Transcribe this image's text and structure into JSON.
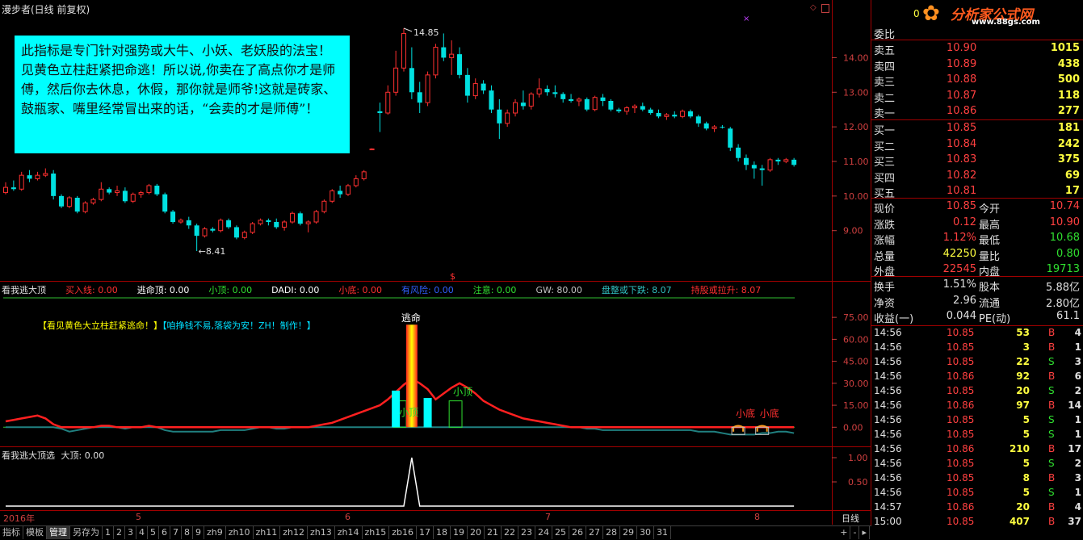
{
  "title": "漫步者(日线 前复权)",
  "callout": "此指标是专门针对强势或大牛、小妖、老妖股的法宝！见黄色立柱赶紧把命逃！所以说,你卖在了高点你才是师傅，然后你去休息，休假，那你就是师爷!这就是砖家、鼓瓶家、嘴里经常冒出来的话，“会卖的才是师傅”！",
  "price_annotations": {
    "high": "14.85",
    "low": "8.41",
    "dollar": "$"
  },
  "indicator1": {
    "name": "看我逃大顶",
    "items": [
      {
        "label": "买入线: 0.00",
        "color": "#ff3030"
      },
      {
        "label": "逃命顶: 0.00",
        "color": "#ffffff"
      },
      {
        "label": "小顶: 0.00",
        "color": "#30e030"
      },
      {
        "label": "DADI: 0.00",
        "color": "#ffffff"
      },
      {
        "label": "小底: 0.00",
        "color": "#ff3030"
      },
      {
        "label": "有风险: 0.00",
        "color": "#3060ff"
      },
      {
        "label": "注意: 0.00",
        "color": "#30e030"
      },
      {
        "label": "GW: 80.00",
        "color": "#c0c0c0"
      },
      {
        "label": "盘整或下跌: 8.07",
        "color": "#30c0c0"
      },
      {
        "label": "持股或拉升: 8.07",
        "color": "#ff3030"
      }
    ],
    "banner_a": "【看见黄色大立柱赶紧逃命！】",
    "banner_b": "【咱挣钱不易,落袋为安！ZH！制作！】",
    "label_escape": "逃命",
    "label_small_top": "小顶",
    "label_small_bottom": "小底"
  },
  "indicator2": {
    "name": "看我逃大顶选",
    "value": "大顶: 0.00"
  },
  "xaxis": {
    "year": "2016年",
    "months": [
      "5",
      "6",
      "7",
      "8"
    ],
    "period": "日线"
  },
  "chart_data": [
    {
      "type": "candlestick",
      "title": "漫步者(日线 前复权)",
      "yticks": [
        9.0,
        10.0,
        11.0,
        12.0,
        13.0,
        14.0
      ],
      "ylim": [
        8.2,
        15.2
      ],
      "ohlc": [
        [
          10.1,
          10.4,
          10.05,
          10.25
        ],
        [
          10.25,
          10.45,
          10.15,
          10.2
        ],
        [
          10.2,
          10.7,
          10.15,
          10.6
        ],
        [
          10.6,
          10.75,
          10.4,
          10.5
        ],
        [
          10.5,
          10.7,
          10.45,
          10.6
        ],
        [
          10.6,
          10.8,
          10.55,
          10.65
        ],
        [
          10.65,
          10.75,
          9.9,
          10.0
        ],
        [
          10.0,
          10.05,
          9.65,
          9.7
        ],
        [
          9.7,
          10.0,
          9.65,
          9.95
        ],
        [
          9.95,
          10.0,
          9.5,
          9.55
        ],
        [
          9.55,
          9.85,
          9.5,
          9.8
        ],
        [
          9.8,
          9.95,
          9.75,
          9.9
        ],
        [
          9.9,
          10.4,
          9.85,
          10.2
        ],
        [
          10.2,
          10.25,
          10.05,
          10.1
        ],
        [
          10.1,
          10.3,
          10.0,
          10.15
        ],
        [
          10.15,
          10.25,
          9.8,
          9.85
        ],
        [
          9.85,
          10.1,
          9.8,
          10.05
        ],
        [
          10.05,
          10.15,
          9.95,
          10.1
        ],
        [
          10.1,
          10.35,
          10.05,
          10.3
        ],
        [
          10.3,
          10.35,
          10.0,
          10.05
        ],
        [
          10.05,
          10.1,
          9.5,
          9.55
        ],
        [
          9.55,
          9.6,
          9.2,
          9.25
        ],
        [
          9.25,
          9.35,
          9.2,
          9.3
        ],
        [
          9.3,
          9.4,
          9.05,
          9.15
        ],
        [
          9.15,
          9.2,
          8.41,
          8.85
        ],
        [
          8.85,
          9.1,
          8.8,
          9.05
        ],
        [
          9.05,
          9.1,
          8.95,
          9.0
        ],
        [
          9.0,
          9.35,
          8.95,
          9.3
        ],
        [
          9.3,
          9.35,
          9.05,
          9.1
        ],
        [
          9.1,
          9.15,
          8.75,
          8.8
        ],
        [
          8.8,
          9.0,
          8.75,
          8.95
        ],
        [
          8.95,
          9.25,
          8.9,
          9.2
        ],
        [
          9.2,
          9.35,
          9.15,
          9.3
        ],
        [
          9.3,
          9.35,
          9.15,
          9.25
        ],
        [
          9.25,
          9.35,
          9.05,
          9.1
        ],
        [
          9.1,
          9.3,
          9.0,
          9.25
        ],
        [
          9.25,
          9.55,
          9.2,
          9.5
        ],
        [
          9.5,
          9.55,
          9.15,
          9.2
        ],
        [
          9.2,
          9.3,
          8.95,
          9.25
        ],
        [
          9.25,
          9.6,
          9.2,
          9.55
        ],
        [
          9.55,
          9.9,
          9.5,
          9.85
        ],
        [
          9.85,
          10.2,
          9.8,
          10.15
        ],
        [
          10.15,
          10.3,
          9.95,
          10.05
        ],
        [
          10.05,
          10.35,
          10.0,
          10.3
        ],
        [
          10.3,
          10.6,
          10.25,
          10.5
        ],
        [
          10.5,
          10.75,
          10.45,
          10.7
        ],
        [
          11.35,
          11.38,
          11.34,
          11.36
        ],
        [
          12.45,
          12.7,
          11.85,
          12.4
        ],
        [
          12.4,
          13.2,
          12.35,
          13.0
        ],
        [
          13.0,
          14.2,
          12.9,
          13.7
        ],
        [
          13.7,
          14.85,
          13.6,
          14.7
        ],
        [
          13.7,
          14.3,
          12.8,
          13.0
        ],
        [
          13.0,
          13.3,
          12.4,
          12.7
        ],
        [
          12.7,
          13.6,
          12.6,
          13.5
        ],
        [
          13.5,
          14.4,
          13.4,
          14.3
        ],
        [
          14.3,
          14.7,
          13.9,
          14.0
        ],
        [
          14.0,
          14.5,
          13.5,
          14.1
        ],
        [
          14.1,
          14.3,
          13.4,
          13.5
        ],
        [
          13.5,
          13.7,
          12.7,
          12.9
        ],
        [
          12.9,
          13.4,
          12.8,
          13.25
        ],
        [
          13.25,
          13.35,
          12.95,
          13.05
        ],
        [
          13.05,
          13.2,
          12.4,
          12.5
        ],
        [
          12.5,
          12.8,
          11.65,
          12.1
        ],
        [
          12.1,
          12.5,
          12.0,
          12.4
        ],
        [
          12.4,
          12.8,
          12.3,
          12.7
        ],
        [
          12.7,
          13.05,
          12.5,
          12.6
        ],
        [
          12.6,
          13.0,
          12.5,
          12.95
        ],
        [
          12.95,
          13.4,
          12.85,
          13.1
        ],
        [
          13.1,
          13.2,
          12.9,
          13.0
        ],
        [
          13.0,
          13.2,
          12.85,
          12.95
        ],
        [
          12.95,
          13.0,
          12.7,
          12.8
        ],
        [
          12.8,
          12.95,
          12.7,
          12.75
        ],
        [
          12.75,
          12.85,
          12.6,
          12.8
        ],
        [
          12.8,
          12.85,
          12.45,
          12.5
        ],
        [
          12.5,
          12.9,
          12.45,
          12.85
        ],
        [
          12.85,
          12.95,
          12.6,
          12.75
        ],
        [
          12.75,
          12.8,
          12.45,
          12.5
        ],
        [
          12.5,
          12.55,
          12.4,
          12.45
        ],
        [
          12.45,
          12.6,
          12.35,
          12.55
        ],
        [
          12.55,
          12.65,
          12.4,
          12.6
        ],
        [
          12.6,
          12.7,
          12.45,
          12.5
        ],
        [
          12.5,
          12.55,
          12.35,
          12.4
        ],
        [
          12.4,
          12.5,
          12.25,
          12.3
        ],
        [
          12.3,
          12.4,
          12.2,
          12.35
        ],
        [
          12.35,
          12.45,
          12.25,
          12.3
        ],
        [
          12.3,
          12.5,
          12.25,
          12.45
        ],
        [
          12.45,
          12.5,
          12.25,
          12.3
        ],
        [
          12.3,
          12.35,
          12.0,
          12.1
        ],
        [
          12.1,
          12.15,
          11.9,
          11.95
        ],
        [
          11.95,
          12.05,
          11.85,
          12.0
        ],
        [
          12.0,
          12.05,
          11.95,
          11.98
        ],
        [
          11.95,
          12.0,
          11.3,
          11.4
        ],
        [
          11.4,
          11.5,
          11.0,
          11.1
        ],
        [
          11.1,
          11.2,
          10.75,
          10.9
        ],
        [
          10.9,
          11.0,
          10.5,
          10.8
        ],
        [
          10.8,
          10.9,
          10.3,
          10.75
        ],
        [
          10.75,
          11.1,
          10.7,
          11.05
        ],
        [
          11.05,
          11.1,
          10.9,
          11.0
        ],
        [
          11.0,
          11.1,
          10.95,
          11.05
        ],
        [
          11.05,
          11.1,
          10.85,
          10.9
        ]
      ]
    },
    {
      "type": "line",
      "title": "看我逃大顶",
      "yticks": [
        0.0,
        15.0,
        30.0,
        45.0,
        60.0,
        75.0
      ],
      "ylim": [
        -7,
        85
      ],
      "series": [
        {
          "name": "持股或拉升",
          "values": [
            4,
            5,
            6,
            7,
            8,
            6,
            2,
            -1,
            -3,
            -2,
            -1,
            0,
            1,
            1,
            0,
            -1,
            0,
            0,
            1,
            0,
            -2,
            -3,
            -3,
            -3,
            -3,
            -3,
            -3,
            -2,
            -2,
            -2,
            -2,
            -1,
            0,
            0,
            -1,
            -1,
            0,
            0,
            0,
            1,
            2,
            3,
            5,
            7,
            9,
            11,
            13,
            15,
            19,
            24,
            29,
            33,
            30,
            26,
            19,
            23,
            27,
            30,
            27,
            23,
            18,
            15,
            12,
            10,
            8,
            6,
            5,
            4,
            3,
            2,
            1,
            0,
            0,
            -1,
            -1,
            -2,
            -2,
            -2,
            -2,
            -2,
            -2,
            -2,
            -2,
            -2,
            -2,
            -2,
            -2,
            -3,
            -3,
            -3,
            -4,
            -5,
            -5,
            -5,
            -5,
            -4,
            -4,
            -3,
            -3,
            -4
          ]
        }
      ],
      "bars": [
        {
          "name": "逃命顶",
          "index": 51,
          "value": 70
        },
        {
          "name": "有风险",
          "index": 49,
          "value": 25
        },
        {
          "name": "有风险",
          "index": 53,
          "value": 20
        }
      ]
    },
    {
      "type": "line",
      "title": "看我逃大顶选",
      "yticks": [
        0.5,
        1.0
      ],
      "ylim": [
        -0.05,
        1.15
      ],
      "series": [
        {
          "name": "大顶",
          "values": [
            0,
            0,
            0,
            0,
            0,
            0,
            0,
            0,
            0,
            0,
            0,
            0,
            0,
            0,
            0,
            0,
            0,
            0,
            0,
            0,
            0,
            0,
            0,
            0,
            0,
            0,
            0,
            0,
            0,
            0,
            0,
            0,
            0,
            0,
            0,
            0,
            0,
            0,
            0,
            0,
            0,
            0,
            0,
            0,
            0,
            0,
            0,
            0,
            0,
            0,
            0,
            1,
            0,
            0,
            0,
            0,
            0,
            0,
            0,
            0,
            0,
            0,
            0,
            0,
            0,
            0,
            0,
            0,
            0,
            0,
            0,
            0,
            0,
            0,
            0,
            0,
            0,
            0,
            0,
            0,
            0,
            0,
            0,
            0,
            0,
            0,
            0,
            0,
            0,
            0,
            0,
            0,
            0,
            0,
            0,
            0,
            0,
            0,
            0,
            0
          ]
        }
      ]
    }
  ],
  "quote_panel": {
    "price_header": "0",
    "weibi_label": "委比",
    "asks": [
      {
        "label": "卖五",
        "price": "10.90",
        "vol": "1015"
      },
      {
        "label": "卖四",
        "price": "10.89",
        "vol": "438"
      },
      {
        "label": "卖三",
        "price": "10.88",
        "vol": "500"
      },
      {
        "label": "卖二",
        "price": "10.87",
        "vol": "118"
      },
      {
        "label": "卖一",
        "price": "10.86",
        "vol": "277"
      }
    ],
    "bids": [
      {
        "label": "买一",
        "price": "10.85",
        "vol": "181"
      },
      {
        "label": "买二",
        "price": "10.84",
        "vol": "242"
      },
      {
        "label": "买三",
        "price": "10.83",
        "vol": "375"
      },
      {
        "label": "买四",
        "price": "10.82",
        "vol": "69"
      },
      {
        "label": "买五",
        "price": "10.81",
        "vol": "17"
      }
    ],
    "stats": [
      {
        "l1": "现价",
        "v1": "10.85",
        "c1": "#ff4040",
        "l2": "今开",
        "v2": "10.74",
        "c2": "#ff4040"
      },
      {
        "l1": "涨跌",
        "v1": "0.12",
        "c1": "#ff4040",
        "l2": "最高",
        "v2": "10.90",
        "c2": "#ff4040"
      },
      {
        "l1": "涨幅",
        "v1": "1.12%",
        "c1": "#ff4040",
        "l2": "最低",
        "v2": "10.68",
        "c2": "#30e030"
      },
      {
        "l1": "总量",
        "v1": "42250",
        "c1": "#ffff40",
        "l2": "量比",
        "v2": "0.80",
        "c2": "#30e030"
      },
      {
        "l1": "外盘",
        "v1": "22545",
        "c1": "#ff4040",
        "l2": "内盘",
        "v2": "19713",
        "c2": "#30e030"
      }
    ],
    "stats2": [
      {
        "l1": "换手",
        "v1": "1.51%",
        "c1": "#e0e0e0",
        "l2": "股本",
        "v2": "5.88亿",
        "c2": "#e0e0e0"
      },
      {
        "l1": "净资",
        "v1": "2.96",
        "c1": "#e0e0e0",
        "l2": "流通",
        "v2": "2.80亿",
        "c2": "#e0e0e0"
      },
      {
        "l1": "收益(一)",
        "v1": "0.044",
        "c1": "#e0e0e0",
        "l2": "PE(动)",
        "v2": "61.1",
        "c2": "#e0e0e0"
      }
    ],
    "ticks": [
      {
        "time": "14:56",
        "price": "10.85",
        "vol": "53",
        "bs": "B",
        "n": "4"
      },
      {
        "time": "14:56",
        "price": "10.85",
        "vol": "3",
        "bs": "B",
        "n": "1"
      },
      {
        "time": "14:56",
        "price": "10.85",
        "vol": "22",
        "bs": "S",
        "n": "3"
      },
      {
        "time": "14:56",
        "price": "10.86",
        "vol": "92",
        "bs": "B",
        "n": "6"
      },
      {
        "time": "14:56",
        "price": "10.85",
        "vol": "20",
        "bs": "S",
        "n": "2"
      },
      {
        "time": "14:56",
        "price": "10.86",
        "vol": "97",
        "bs": "B",
        "n": "14"
      },
      {
        "time": "14:56",
        "price": "10.85",
        "vol": "5",
        "bs": "S",
        "n": "1"
      },
      {
        "time": "14:56",
        "price": "10.85",
        "vol": "5",
        "bs": "S",
        "n": "1"
      },
      {
        "time": "14:56",
        "price": "10.86",
        "vol": "210",
        "bs": "B",
        "n": "17"
      },
      {
        "time": "14:56",
        "price": "10.85",
        "vol": "5",
        "bs": "S",
        "n": "2"
      },
      {
        "time": "14:56",
        "price": "10.85",
        "vol": "8",
        "bs": "B",
        "n": "3"
      },
      {
        "time": "14:56",
        "price": "10.85",
        "vol": "5",
        "bs": "S",
        "n": "1"
      },
      {
        "time": "14:57",
        "price": "10.86",
        "vol": "20",
        "bs": "B",
        "n": "4"
      },
      {
        "time": "15:00",
        "price": "10.85",
        "vol": "407",
        "bs": "B",
        "n": "37"
      }
    ]
  },
  "logo": {
    "brand": "分析家公式网",
    "url": "www.88gs.com"
  },
  "bottom_tabs": [
    "指标",
    "模板",
    "管理",
    "另存为",
    "1",
    "2",
    "3",
    "4",
    "5",
    "6",
    "7",
    "8",
    "9",
    "zh9",
    "zh10",
    "zh11",
    "zh12",
    "zh13",
    "zh14",
    "zh15",
    "zb16",
    "17",
    "18",
    "19",
    "20",
    "21",
    "22",
    "23",
    "24",
    "25",
    "26",
    "27",
    "28",
    "29",
    "30",
    "31"
  ],
  "bottom_controls": [
    "+",
    "-",
    "▸"
  ],
  "colors": {
    "up": "#ff3030",
    "down": "#00e0e0",
    "accent": "#ffff00",
    "callout_bg": "#00ffff"
  }
}
